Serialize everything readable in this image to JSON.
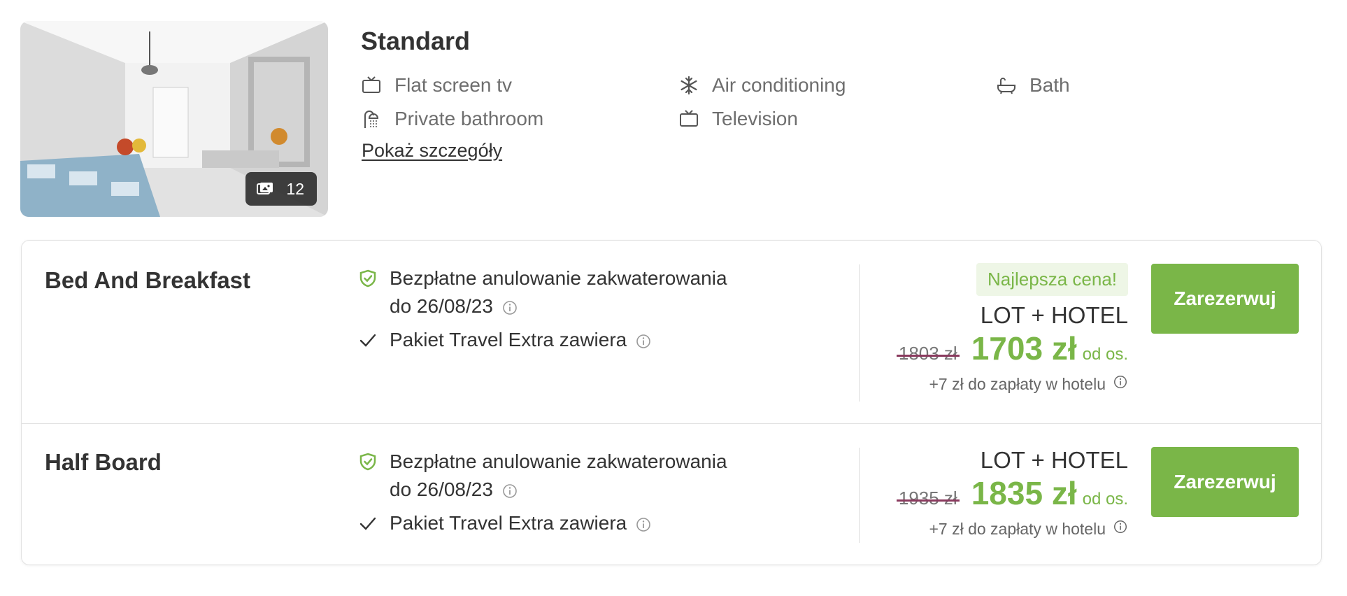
{
  "room": {
    "title": "Standard",
    "photo_count": "12",
    "amenities": [
      {
        "label": "Flat screen tv",
        "icon": "tv-icon"
      },
      {
        "label": "Air conditioning",
        "icon": "snowflake-icon"
      },
      {
        "label": "Bath",
        "icon": "bathtub-icon"
      },
      {
        "label": "Private bathroom",
        "icon": "shower-icon"
      },
      {
        "label": "Television",
        "icon": "tv-icon"
      }
    ],
    "details_link": "Pokaż szczegóły"
  },
  "offers": [
    {
      "board": "Bed And Breakfast",
      "cancellation_line1": "Bezpłatne anulowanie zakwaterowania",
      "cancellation_line2": "do 26/08/23",
      "package_feature": "Pakiet Travel Extra zawiera",
      "best_price_badge": "Najlepsza cena!",
      "package_label": "LOT + HOTEL",
      "old_price": "1803 zł",
      "new_price": "1703 zł",
      "per_person": "od os.",
      "hotel_fee": "+7 zł do zapłaty w hotelu",
      "book_label": "Zarezerwuj"
    },
    {
      "board": "Half Board",
      "cancellation_line1": "Bezpłatne anulowanie zakwaterowania",
      "cancellation_line2": "do 26/08/23",
      "package_feature": "Pakiet Travel Extra zawiera",
      "package_label": "LOT + HOTEL",
      "old_price": "1935 zł",
      "new_price": "1835 zł",
      "per_person": "od os.",
      "hotel_fee": "+7 zł do zapłaty w hotelu",
      "book_label": "Zarezerwuj"
    }
  ],
  "colors": {
    "accent_green": "#7ab648",
    "best_price_bg": "#eef6e6",
    "strike": "#8a3a5e",
    "text": "#333333",
    "muted": "#6e6e6e"
  }
}
